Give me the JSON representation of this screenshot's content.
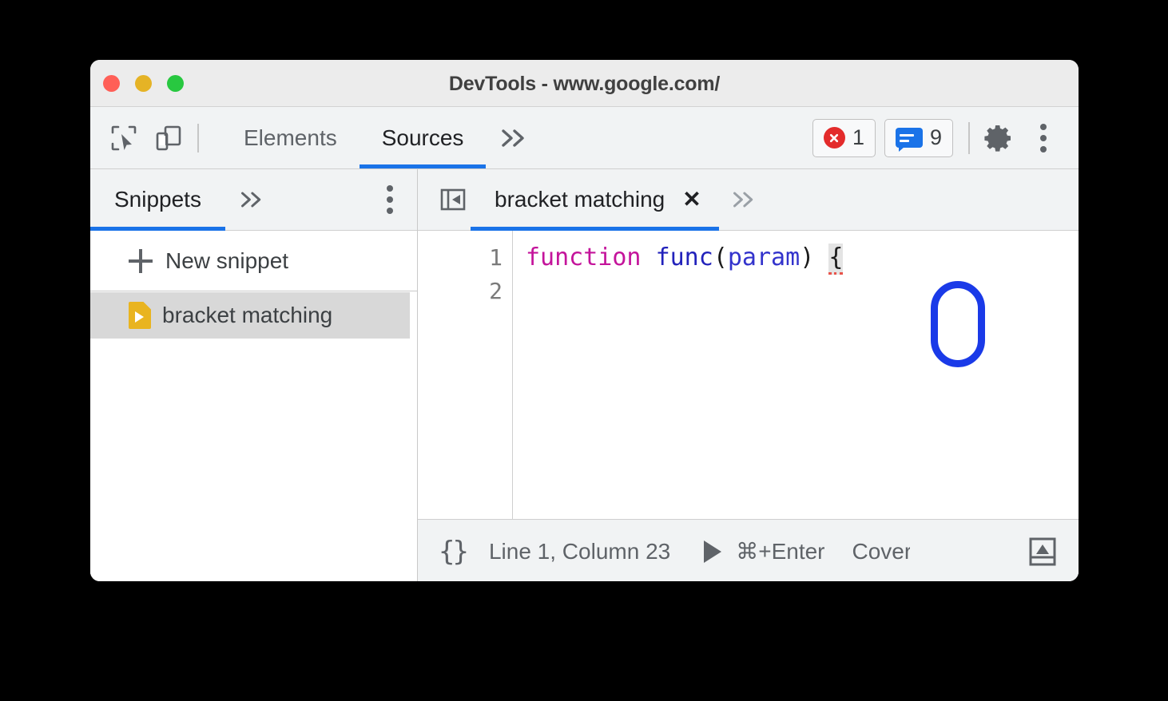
{
  "window": {
    "title": "DevTools - www.google.com/",
    "traffic_lights": [
      "close",
      "minimize",
      "maximize"
    ],
    "colors": {
      "close": "#ff5f57",
      "minimize": "#e5b326",
      "maximize": "#28c840",
      "accent": "#1a73e8",
      "error": "#e32b2b",
      "snippet": "#e9b420",
      "annotation": "#1a3ae8"
    }
  },
  "toolbar": {
    "inspect_icon": "inspect-element-icon",
    "device_icon": "device-toolbar-icon",
    "tabs": [
      {
        "label": "Elements",
        "active": false
      },
      {
        "label": "Sources",
        "active": true
      }
    ],
    "more_tabs_icon": "chevron-double-right-icon",
    "error_badge": {
      "icon": "error-circle-icon",
      "count": "1"
    },
    "message_badge": {
      "icon": "message-bubble-icon",
      "count": "9"
    },
    "settings_icon": "gear-icon",
    "more_options_icon": "kebab-menu-icon"
  },
  "sidebar": {
    "tab_label": "Snippets",
    "more_tabs_icon": "chevron-double-right-icon",
    "more_options_icon": "kebab-menu-icon",
    "new_snippet_label": "New snippet",
    "new_snippet_icon": "plus-icon",
    "items": [
      {
        "label": "bracket matching",
        "icon": "snippet-file-icon",
        "selected": true
      }
    ]
  },
  "editor": {
    "collapse_icon": "collapse-sidebar-icon",
    "tab": {
      "label": "bracket matching",
      "close_icon": "close-icon"
    },
    "more_tabs_icon": "chevron-double-right-icon",
    "line_numbers": [
      "1",
      "2"
    ],
    "code": {
      "keyword": "function",
      "space1": " ",
      "function_name": "func",
      "open_paren": "(",
      "param": "param",
      "close_paren": ")",
      "space2": " ",
      "brace": "{"
    }
  },
  "statusbar": {
    "pretty_print_icon": "{}",
    "cursor_position": "Line 1, Column 23",
    "run_icon": "play-icon",
    "run_shortcut": "⌘+Enter",
    "coverage_label": "Coverage",
    "drawer_icon": "show-drawer-icon"
  }
}
